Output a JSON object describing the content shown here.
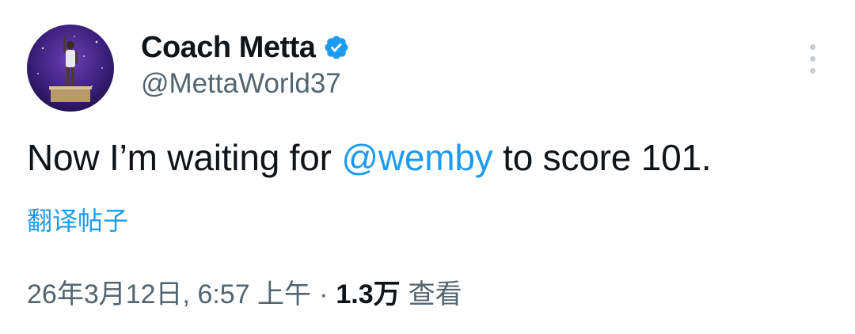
{
  "author": {
    "display_name": "Coach Metta",
    "handle": "@MettaWorld37",
    "verified": true,
    "verified_color": "#1d9bf0"
  },
  "tweet": {
    "text_before": "Now I’m waiting for ",
    "mention": "@wemby",
    "text_after": " to score 101."
  },
  "translate_label": "翻译帖子",
  "meta": {
    "timestamp": "26年3月12日, 6:57 上午",
    "separator": "·",
    "views_count": "1.3万",
    "views_label": "查看"
  },
  "icons": {
    "avatar": "avatar-image",
    "verified": "verified-badge-icon",
    "more": "more-options-icon"
  },
  "colors": {
    "accent": "#1d9bf0",
    "text_primary": "#0f1419",
    "text_secondary": "#536471"
  }
}
